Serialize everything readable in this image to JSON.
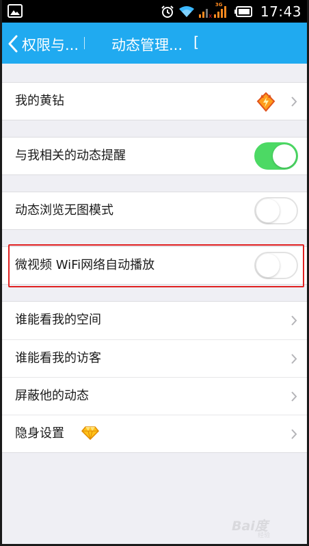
{
  "status_bar": {
    "time": "17:43",
    "network_label": "3G",
    "icons": [
      "photo-icon",
      "alarm-icon",
      "wifi-icon",
      "signal-icon",
      "battery-icon"
    ],
    "network_label_color": "#ff8a1f"
  },
  "title_bar": {
    "back_label": "权限与...",
    "title": "动态管理...",
    "extra": "[",
    "background_color": "#20aaf0"
  },
  "rows": {
    "yellow_diamond": {
      "label": "我的黄钻",
      "icon": "yellow-diamond-badge-icon"
    },
    "related_notify": {
      "label": "与我相关的动态提醒",
      "toggle": "on"
    },
    "no_image_mode": {
      "label": "动态浏览无图模式",
      "toggle": "off"
    },
    "wifi_autoplay": {
      "label": "微视频 WiFi网络自动播放",
      "toggle": "off"
    },
    "who_space": {
      "label": "谁能看我的空间"
    },
    "who_visitors": {
      "label": "谁能看我的访客"
    },
    "block_feeds": {
      "label": "屏蔽他的动态"
    },
    "stealth": {
      "label": "隐身设置",
      "icon": "gem-icon"
    }
  },
  "colors": {
    "toggle_on": "#4cd964",
    "highlight": "#e02020"
  }
}
